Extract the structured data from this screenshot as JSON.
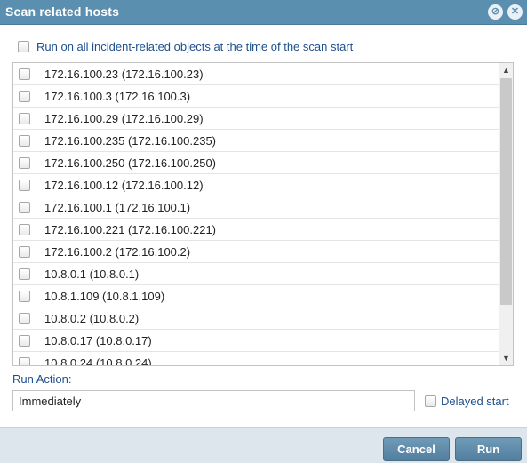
{
  "dialog": {
    "title": "Scan related hosts",
    "run_all_label": "Run on all incident-related objects at the time of the scan start",
    "run_all_checked": false
  },
  "hosts": [
    "172.16.100.23 (172.16.100.23)",
    "172.16.100.3 (172.16.100.3)",
    "172.16.100.29 (172.16.100.29)",
    "172.16.100.235 (172.16.100.235)",
    "172.16.100.250 (172.16.100.250)",
    "172.16.100.12 (172.16.100.12)",
    "172.16.100.1 (172.16.100.1)",
    "172.16.100.221 (172.16.100.221)",
    "172.16.100.2 (172.16.100.2)",
    "10.8.0.1 (10.8.0.1)",
    "10.8.1.109 (10.8.1.109)",
    "10.8.0.2 (10.8.0.2)",
    "10.8.0.17 (10.8.0.17)",
    "10.8.0.24 (10.8.0.24)"
  ],
  "run_action": {
    "label": "Run Action:",
    "value": "Immediately",
    "delayed_label": "Delayed start",
    "delayed_checked": false
  },
  "buttons": {
    "cancel": "Cancel",
    "run": "Run"
  },
  "icons": {
    "restore": "restore-icon",
    "close": "close-icon",
    "scroll_up": "chevron-up-icon",
    "scroll_down": "chevron-down-icon"
  },
  "colors": {
    "titlebar": "#5b8fb0",
    "label_blue": "#1e4f8c",
    "button": "#5f8aa8",
    "footer": "#dde6ed"
  }
}
